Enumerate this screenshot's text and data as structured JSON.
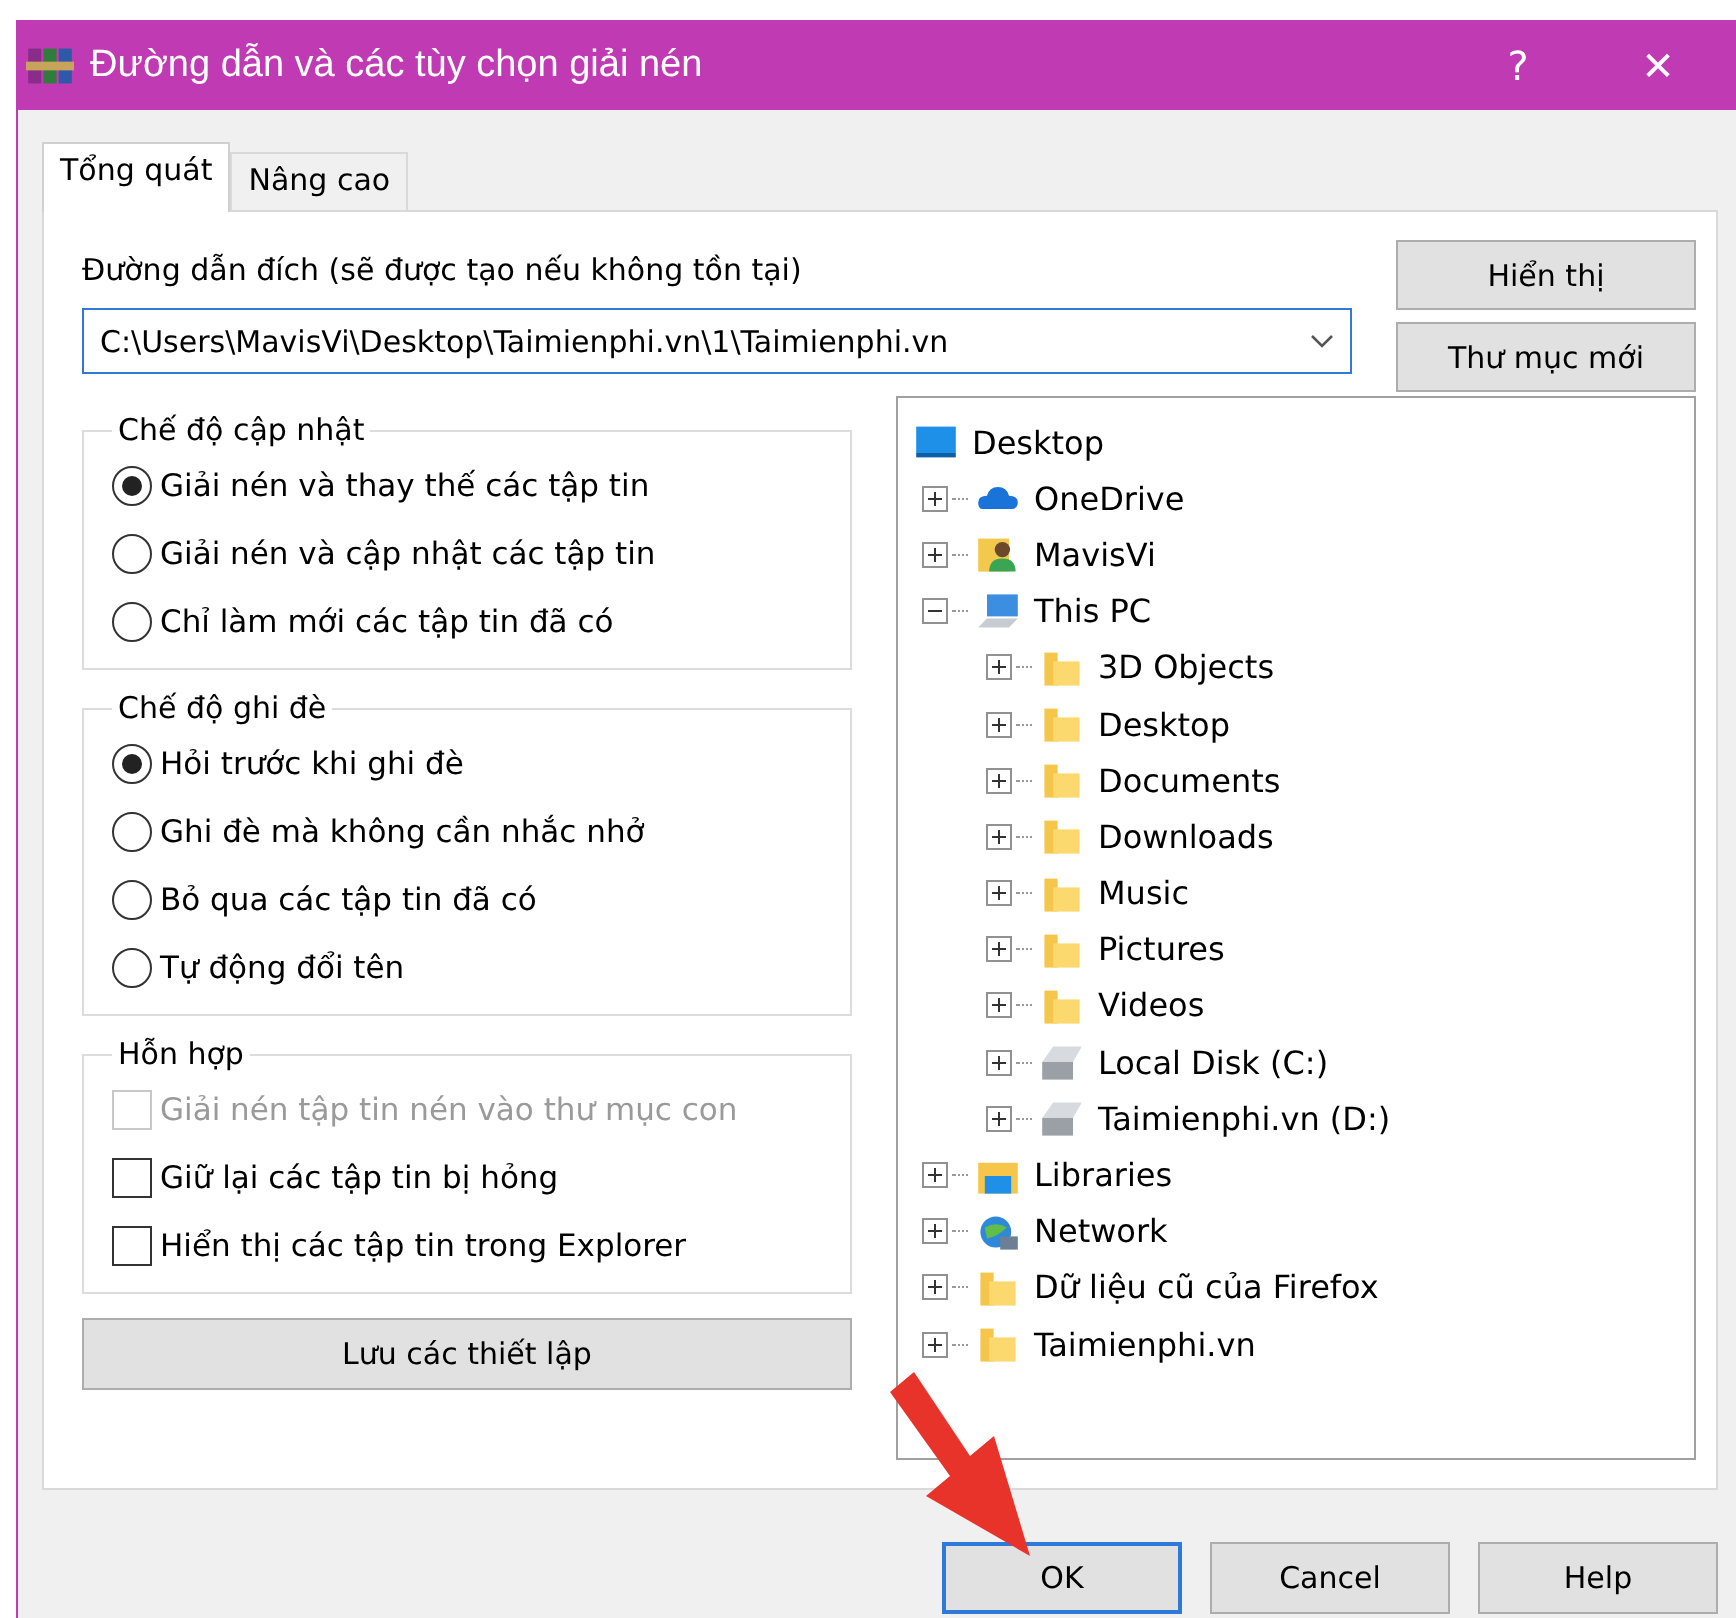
{
  "window": {
    "title": "Đường dẫn và các tùy chọn giải nén",
    "help": "?",
    "close": "✕"
  },
  "tabs": [
    {
      "label": "Tổng quát",
      "selected": true
    },
    {
      "label": "Nâng cao",
      "selected": false
    }
  ],
  "destination": {
    "label": "Đường dẫn đích (sẽ được tạo nếu không tồn tại)",
    "value": "C:\\Users\\MavisVi\\Desktop\\Taimienphi.vn\\1\\Taimienphi.vn"
  },
  "side_buttons": [
    "Hiển thị",
    "Thư mục mới"
  ],
  "groups": [
    {
      "title": "Chế độ cập nhật",
      "kind": "radio",
      "options": [
        {
          "label": "Giải nén và thay thế các tập tin",
          "selected": true
        },
        {
          "label": "Giải nén và cập nhật các tập tin",
          "selected": false
        },
        {
          "label": "Chỉ làm mới các tập tin đã có",
          "selected": false
        }
      ]
    },
    {
      "title": "Chế độ ghi đè",
      "kind": "radio",
      "options": [
        {
          "label": "Hỏi trước khi ghi đè",
          "selected": true
        },
        {
          "label": "Ghi đè mà không cần nhắc nhở",
          "selected": false
        },
        {
          "label": "Bỏ qua các tập tin đã có",
          "selected": false
        },
        {
          "label": "Tự động đổi tên",
          "selected": false
        }
      ]
    },
    {
      "title": "Hỗn hợp",
      "kind": "check",
      "options": [
        {
          "label": "Giải nén tập tin nén vào thư mục con",
          "checked": false,
          "disabled": true
        },
        {
          "label": "Giữ lại các tập tin bị hỏng",
          "checked": false,
          "disabled": false
        },
        {
          "label": "Hiển thị các tập tin trong Explorer",
          "checked": false,
          "disabled": false
        }
      ]
    }
  ],
  "save_button": "Lưu các thiết lập",
  "tree": {
    "label": "Desktop",
    "kind": "desktop",
    "children": [
      {
        "label": "OneDrive",
        "kind": "cloud",
        "expanded": false
      },
      {
        "label": "MavisVi",
        "kind": "user",
        "expanded": false
      },
      {
        "label": "This PC",
        "kind": "pc",
        "expanded": true,
        "children": [
          {
            "label": "3D Objects",
            "kind": "folder",
            "expanded": false
          },
          {
            "label": "Desktop",
            "kind": "folder",
            "expanded": false
          },
          {
            "label": "Documents",
            "kind": "folder",
            "expanded": false
          },
          {
            "label": "Downloads",
            "kind": "folder",
            "expanded": false
          },
          {
            "label": "Music",
            "kind": "folder",
            "expanded": false
          },
          {
            "label": "Pictures",
            "kind": "folder",
            "expanded": false
          },
          {
            "label": "Videos",
            "kind": "folder",
            "expanded": false
          },
          {
            "label": "Local Disk (C:)",
            "kind": "drive",
            "expanded": false
          },
          {
            "label": "Taimienphi.vn (D:)",
            "kind": "drive",
            "expanded": false
          }
        ]
      },
      {
        "label": "Libraries",
        "kind": "library",
        "expanded": false
      },
      {
        "label": "Network",
        "kind": "network",
        "expanded": false
      },
      {
        "label": "Dữ liệu cũ của Firefox",
        "kind": "folder",
        "expanded": false
      },
      {
        "label": "Taimienphi.vn",
        "kind": "folder",
        "expanded": false
      }
    ]
  },
  "footer_buttons": [
    {
      "label": "OK",
      "default": true
    },
    {
      "label": "Cancel",
      "default": false
    },
    {
      "label": "Help",
      "default": false
    }
  ],
  "annotation": {
    "kind": "arrow"
  }
}
